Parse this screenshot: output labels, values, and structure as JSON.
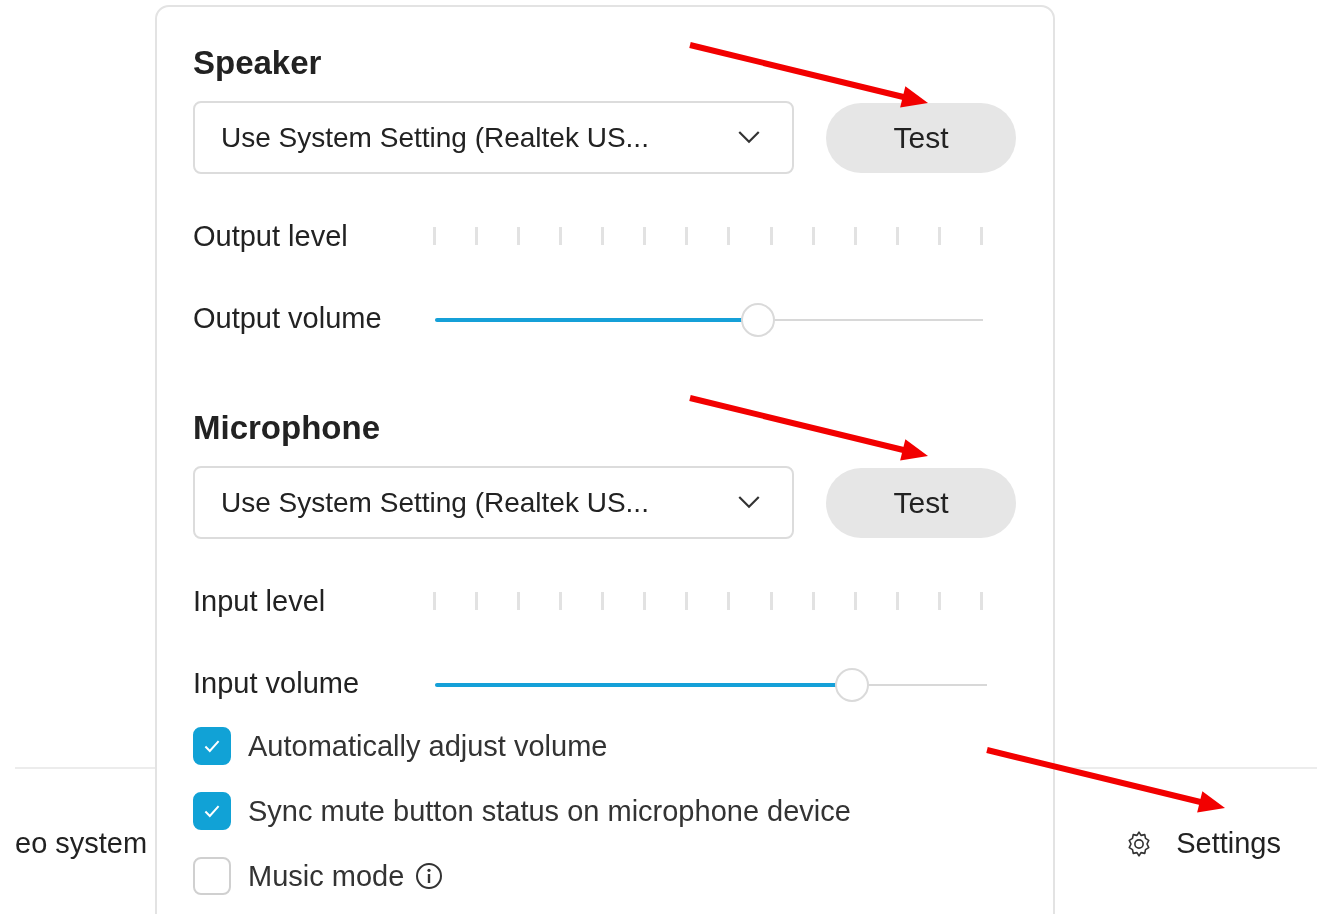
{
  "footer": {
    "left_text": "eo system",
    "settings_label": "Settings"
  },
  "speaker": {
    "heading": "Speaker",
    "device": "Use System Setting (Realtek US...",
    "test_label": "Test",
    "level_label": "Output level",
    "volume_label": "Output volume",
    "volume": {
      "level": 0.59
    }
  },
  "microphone": {
    "heading": "Microphone",
    "device": "Use System Setting (Realtek US...",
    "test_label": "Test",
    "level_label": "Input level",
    "volume_label": "Input volume",
    "volume": {
      "level": 0.755
    }
  },
  "options": [
    {
      "label": "Automatically adjust volume",
      "checked": true,
      "info": false
    },
    {
      "label": "Sync mute button status on microphone device",
      "checked": true,
      "info": false
    },
    {
      "label": "Music mode",
      "checked": false,
      "info": true
    }
  ]
}
